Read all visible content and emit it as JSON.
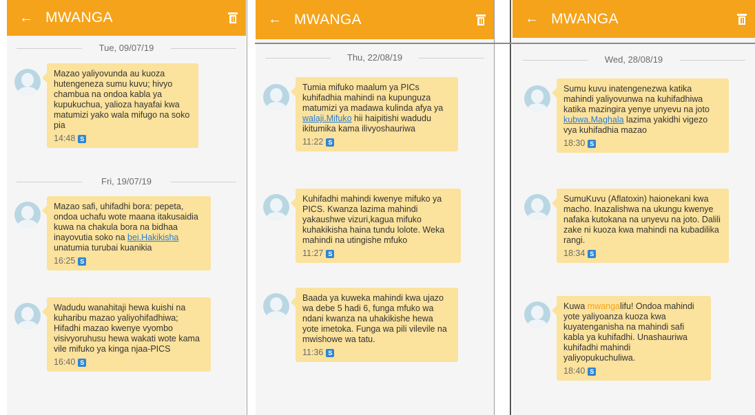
{
  "app_title": "MWANGA",
  "icons": {
    "back": "back-arrow-icon",
    "delete": "trash-icon",
    "avatar": "contact-avatar-icon",
    "sim": "sim-icon"
  },
  "colors": {
    "appbar": "#f5a31a",
    "bubble": "#fbe29d",
    "link": "#2a7bd0",
    "sim": "#2f86d4"
  },
  "panels": [
    {
      "dates": [
        "Tue, 09/07/19",
        "Fri, 19/07/19"
      ],
      "messages": [
        {
          "pre": "Mazao yaliyovunda au kuoza hutengeneza sumu kuvu; hivyo chambua na ondoa kabla ya kupukuchua, yalioza hayafai kwa matumizi yako wala mifugo na soko pia",
          "time": "14:48"
        },
        {
          "pre": "Mazao safi, uhifadhi bora: pepeta, ondoa uchafu wote maana itakusaidia kuwa na chakula bora na bidhaa inayovutia soko na ",
          "link": "bei.Hakikisha",
          "post": " unatumia turubai kuanikia",
          "time": "16:25"
        },
        {
          "pre": "Wadudu wanahitaji hewa kuishi na kuharibu mazao yaliyohifadhiwa; Hifadhi mazao kwenye vyombo visivyoruhusu hewa wakati wote kama vile mifuko ya kinga njaa-PICS",
          "time": "16:40"
        }
      ]
    },
    {
      "dates": [
        "Thu, 22/08/19"
      ],
      "messages": [
        {
          "pre": "Tumia mifuko maalum ya PICs kuhifadhia mahindi na kupunguza matumizi ya madawa kulinda afya ya ",
          "link": "walaji.Mifuko",
          "post": " hii haipitishi wadudu ikitumika kama ilivyoshauriwa",
          "time": "11:22"
        },
        {
          "pre": "Kuhifadhi mahindi kwenye mifuko ya PICS. Kwanza lazima mahindi yakaushwe vizuri,kagua mifuko kuhakikisha haina tundu lolote. Weka mahindi na utingishe mfuko",
          "time": "11:27"
        },
        {
          "pre": "Baada ya kuweka mahindi kwa ujazo wa debe 5 hadi 6, funga mfuko wa ndani kwanza na uhakikishe hewa yote imetoka. Funga wa pili vilevile na mwishowe wa tatu.",
          "time": "11:36"
        }
      ]
    },
    {
      "dates": [
        "Wed, 28/08/19"
      ],
      "messages": [
        {
          "pre": "Sumu kuvu inatengenezwa katika mahindi yaliyovunwa na kuhifadhiwa katika mazingira yenye unyevu na joto ",
          "link": "kubwa.Maghala",
          "post": " lazima yakidhi vigezo vya kuhifadhia mazao",
          "time": "18:30"
        },
        {
          "pre": "SumuKuvu (Aflatoxin) haionekani kwa macho. Inazalishwa na ukungu kwenye nafaka kutokana na unyevu na joto. Dalili zake ni kuoza kwa mahindi na kubadilika rangi.",
          "time": "18:34"
        },
        {
          "pre": "Kuwa ",
          "hl": "mwanga",
          "post": "lifu! Ondoa mahindi yote yaliyoanza kuoza kwa kuyatenganisha na mahindi safi kabla ya kuhifadhi. Unashauriwa kuhifadhi mahindi yaliyopukuchuliwa.",
          "time": "18:40"
        }
      ]
    }
  ]
}
